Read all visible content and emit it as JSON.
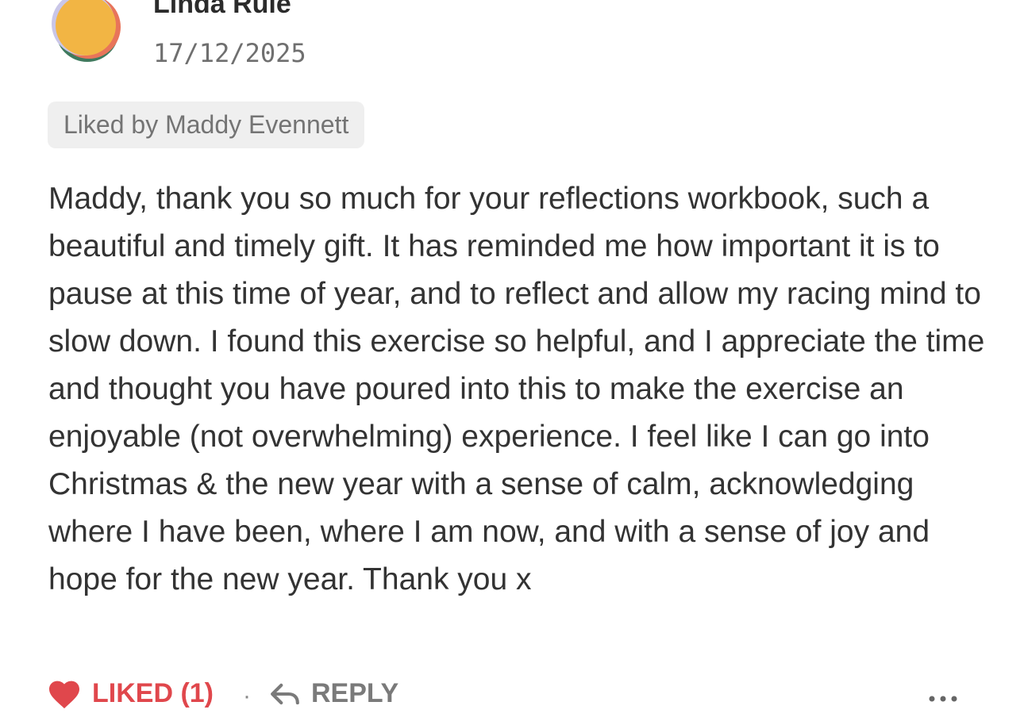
{
  "comment": {
    "author": {
      "name": "Linda Rule",
      "avatar_colors": [
        "#f2b544",
        "#e8745a",
        "#3f7a5e",
        "#c9c6e8"
      ]
    },
    "date": "17/12/2025",
    "liked_by": "Liked by Maddy Evennett",
    "body": "Maddy, thank you so much for your reflections workbook, such a beautiful and timely gift. It has reminded me how important it is to pause at this time of year, and to reflect and allow my racing mind to slow down. I found this exercise so helpful, and I appreciate the time and thought you have poured into this to make the exercise an enjoyable (not overwhelming) experience. I feel like I can go into Christmas & the new year with a sense of calm, acknowledging where I have been, where I am now, and with a sense of joy and hope for the new year. Thank you x",
    "actions": {
      "like_label": "LIKED (1)",
      "separator": "·",
      "reply_label": "REPLY",
      "more_icon": "more-horizontal-icon"
    },
    "colors": {
      "like": "#e0474c",
      "muted": "#7a7a7a",
      "badge_bg": "#efefef"
    }
  }
}
